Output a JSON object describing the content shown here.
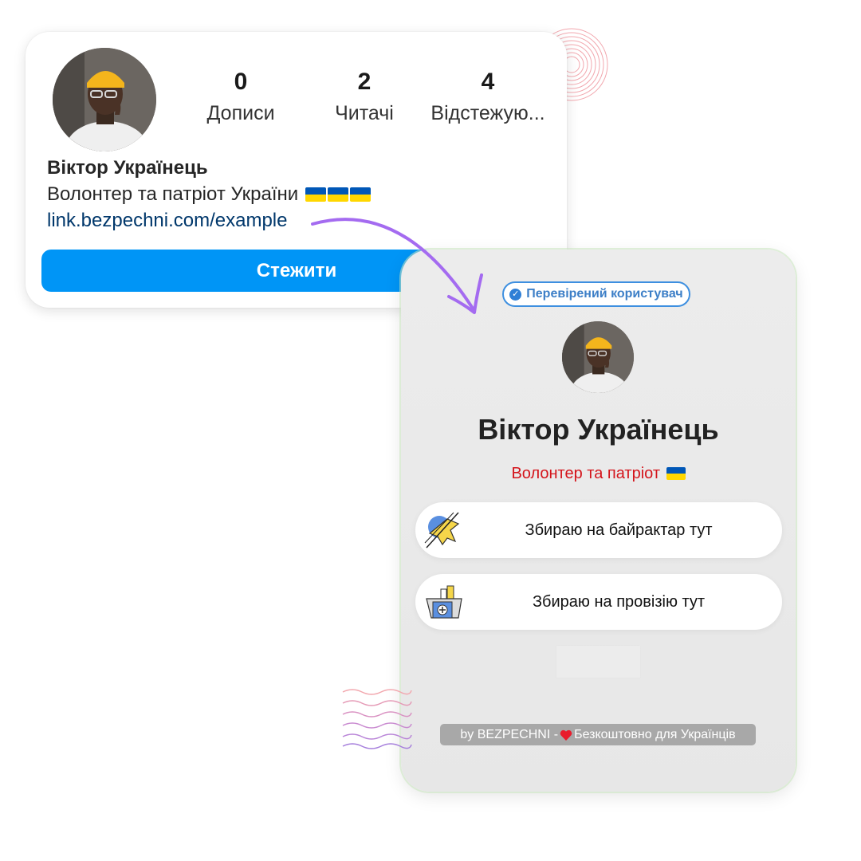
{
  "profile": {
    "stats": [
      {
        "value": "0",
        "label": "Дописи"
      },
      {
        "value": "2",
        "label": "Читачі"
      },
      {
        "value": "4",
        "label": "Відстежую..."
      }
    ],
    "name": "Віктор Українець",
    "bio": "Волонтер та патріот України",
    "link": "link.bezpechni.com/example",
    "follow_label": "Стежити"
  },
  "link_page": {
    "verified_label": "Перевірений користувач",
    "name": "Віктор Українець",
    "bio": "Волонтер та патріот",
    "links": [
      {
        "label": "Збираю на байрактар тут",
        "icon": "drone-icon"
      },
      {
        "label": "Збираю на провізію тут",
        "icon": "supplies-box-icon"
      }
    ],
    "footer_prefix": "by BEZPECHNI -",
    "footer_suffix": "Безкоштовно для Українців"
  },
  "colors": {
    "follow_button": "#0095f6",
    "link_text": "#00376b",
    "verified_badge": "#3d8fe0",
    "bio_red": "#d4141b",
    "arrow": "#a46bf0"
  }
}
